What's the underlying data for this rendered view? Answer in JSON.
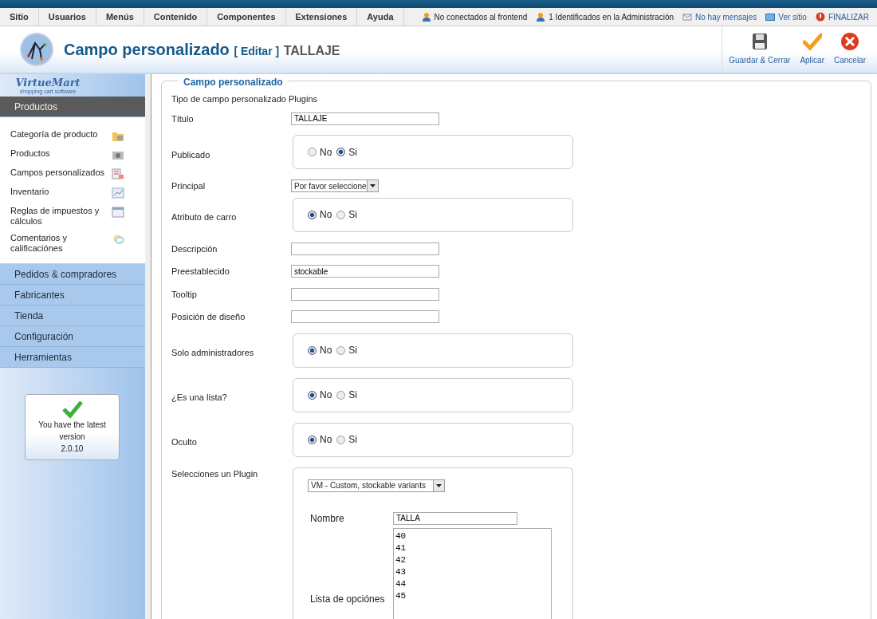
{
  "menu": [
    "Sitio",
    "Usuarios",
    "Menús",
    "Contenido",
    "Componentes",
    "Extensiones",
    "Ayuda"
  ],
  "status": [
    {
      "kind": "users",
      "label": "No conectados al frontend"
    },
    {
      "kind": "users",
      "label": "1 Identificados en la Administración"
    },
    {
      "kind": "mail",
      "label": "No hay mensajes"
    },
    {
      "kind": "screen",
      "label": "Ver sitio"
    },
    {
      "kind": "logout",
      "label": "FINALIZAR"
    }
  ],
  "header": {
    "title": "Campo personalizado",
    "action": "[ Editar ]",
    "subject": "TALLAJE"
  },
  "toolbar": [
    {
      "kind": "save",
      "label": "Guardar & Cerrar"
    },
    {
      "kind": "apply",
      "label": "Aplicar"
    },
    {
      "kind": "cancel",
      "label": "Cancelar"
    }
  ],
  "sidebar": {
    "logo": "VirtueMart",
    "logo_tagline": "shopping cart software",
    "sections": [
      {
        "label": "Productos",
        "expanded": true,
        "items": [
          {
            "label": "Categoría de producto",
            "kind": "folder"
          },
          {
            "label": "Productos",
            "kind": "camera"
          },
          {
            "label": "Campos personalizados",
            "kind": "doc"
          },
          {
            "label": "Inventario",
            "kind": "chart"
          },
          {
            "label": "Reglas de impuestos y cálculos",
            "kind": "calendar"
          },
          {
            "label": "Comentarios y calificaciónes",
            "kind": "bubble"
          }
        ]
      },
      {
        "label": "Pedidos & compradores",
        "expanded": false
      },
      {
        "label": "Fabricantes",
        "expanded": false
      },
      {
        "label": "Tienda",
        "expanded": false
      },
      {
        "label": "Configuración",
        "expanded": false
      },
      {
        "label": "Herramientas",
        "expanded": false
      }
    ],
    "version": {
      "text": "You have the latest version",
      "number": "2.0.10"
    }
  },
  "form": {
    "legend": "Campo personalizado",
    "fields": [
      {
        "kind": "text",
        "label": "Tipo de campo personalizado Plugins"
      },
      {
        "kind": "input",
        "label": "Título",
        "value": "TALLAJE"
      },
      {
        "kind": "radio",
        "label": "Publicado",
        "options": [
          {
            "label": "No",
            "selected": false
          },
          {
            "label": "Si",
            "selected": true
          }
        ]
      },
      {
        "kind": "select",
        "label": "Principal",
        "value": "Por favor seleccione"
      },
      {
        "kind": "radio",
        "label": "Atributo de carro",
        "options": [
          {
            "label": "No",
            "selected": true
          },
          {
            "label": "Si",
            "selected": false
          }
        ]
      },
      {
        "kind": "input",
        "label": "Descripción"
      },
      {
        "kind": "input",
        "label": "Preestablecido",
        "value": "stockable"
      },
      {
        "kind": "input",
        "label": "Tooltip"
      },
      {
        "kind": "input",
        "label": "Posición de diseño"
      },
      {
        "kind": "radio",
        "label": "Solo administradores",
        "options": [
          {
            "label": "No",
            "selected": true
          },
          {
            "label": "Si",
            "selected": false
          }
        ]
      },
      {
        "kind": "radio",
        "label": "¿Es una lista?",
        "options": [
          {
            "label": "No",
            "selected": true
          },
          {
            "label": "Si",
            "selected": false
          }
        ]
      },
      {
        "kind": "radio",
        "label": "Oculto",
        "options": [
          {
            "label": "No",
            "selected": true
          },
          {
            "label": "Si",
            "selected": false
          }
        ]
      },
      {
        "kind": "plugin",
        "label": "Selecciones un Plugin",
        "select": "VM - Custom, stockable variants",
        "name_label": "Nombre",
        "name_value": "TALLA",
        "options_label": "Lista de opciónes",
        "options_value": "40\n41\n42\n43\n44\n45"
      }
    ]
  }
}
